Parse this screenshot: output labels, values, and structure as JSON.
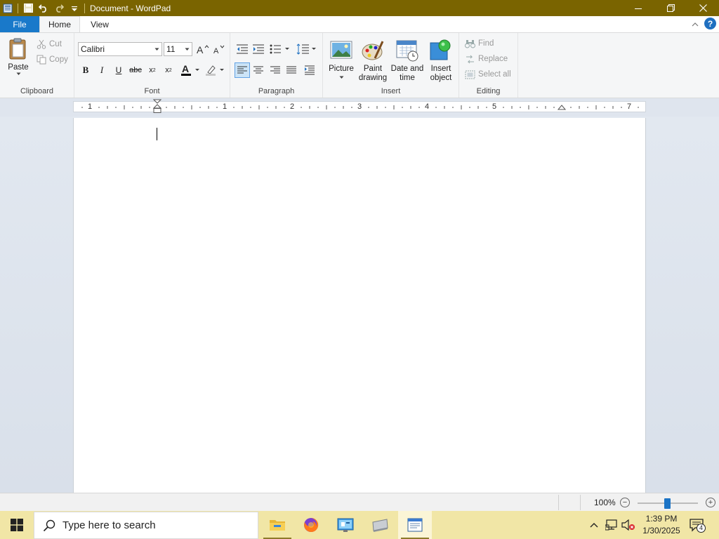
{
  "window": {
    "title": "Document - WordPad"
  },
  "tabs": [
    {
      "label": "File"
    },
    {
      "label": "Home"
    },
    {
      "label": "View"
    }
  ],
  "clipboard": {
    "paste_label": "Paste",
    "cut_label": "Cut",
    "copy_label": "Copy",
    "group_label": "Clipboard"
  },
  "font": {
    "family": "Calibri",
    "size": "11",
    "group_label": "Font"
  },
  "paragraph": {
    "group_label": "Paragraph"
  },
  "insert": {
    "picture_label": "Picture",
    "paint_label_1": "Paint",
    "paint_label_2": "drawing",
    "datetime_label_1": "Date and",
    "datetime_label_2": "time",
    "object_label_1": "Insert",
    "object_label_2": "object",
    "group_label": "Insert"
  },
  "editing": {
    "find_label": "Find",
    "replace_label": "Replace",
    "select_all_label": "Select all",
    "group_label": "Editing"
  },
  "ruler": {
    "numbers": [
      "1",
      "1",
      "2",
      "3",
      "4",
      "5",
      "7"
    ]
  },
  "status": {
    "zoom": "100%"
  },
  "taskbar": {
    "search_placeholder": "Type here to search",
    "time": "1:39 PM",
    "date": "1/30/2025",
    "notification_count": "4"
  },
  "colors": {
    "titlebar": "#7a6400",
    "file_tab": "#1979ca",
    "taskbar": "#f1e6a6",
    "accent": "#1c74c6"
  }
}
